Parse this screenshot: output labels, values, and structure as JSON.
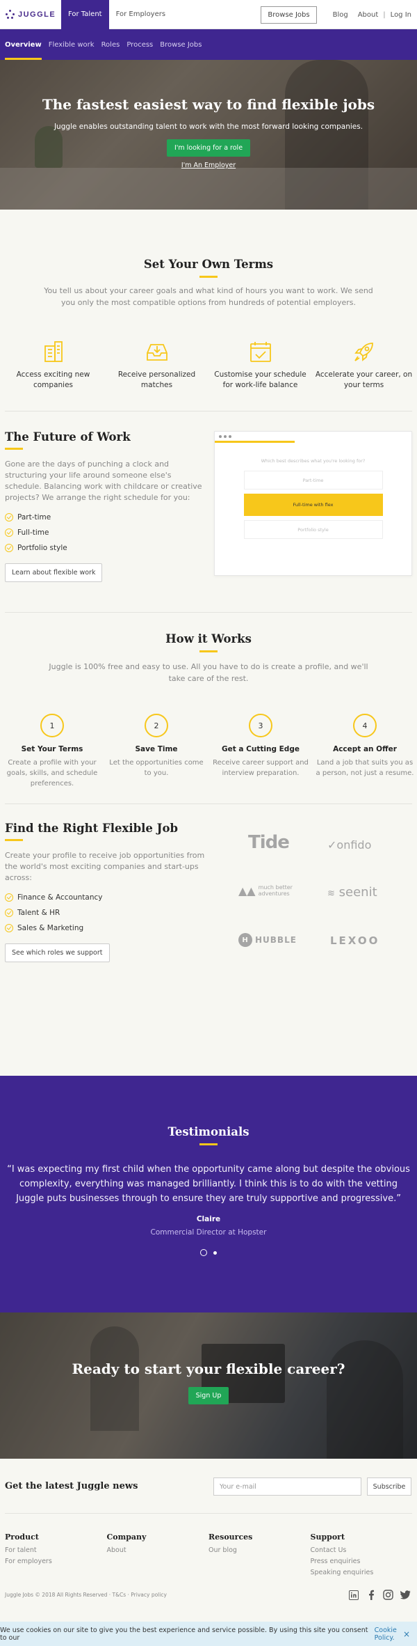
{
  "topnav": {
    "logo": "JUGGLE",
    "tab_talent": "For Talent",
    "tab_employers": "For Employers",
    "browse_jobs": "Browse Jobs",
    "blog": "Blog",
    "about": "About",
    "separator": "|",
    "login": "Log In"
  },
  "subnav": {
    "items": [
      "Overview",
      "Flexible work",
      "Roles",
      "Process",
      "Browse Jobs"
    ],
    "active": "Overview"
  },
  "hero": {
    "title": "The fastest easiest way to find flexible jobs",
    "subtitle": "Juggle enables outstanding talent to work with the most forward looking companies.",
    "cta": "I'm looking for a role",
    "employer_link": "I'm An Employer"
  },
  "terms": {
    "title": "Set Your Own Terms",
    "lead": "You tell us about your career goals and what kind of hours you want to work. We send you only the most compatible options from hundreds of potential employers.",
    "features": [
      {
        "icon": "buildings-icon",
        "label": "Access exciting new companies"
      },
      {
        "icon": "inbox-icon",
        "label": "Receive personalized matches"
      },
      {
        "icon": "calendar-check-icon",
        "label": "Customise your schedule for work-life balance"
      },
      {
        "icon": "rocket-icon",
        "label": "Accelerate your career, on your terms"
      }
    ]
  },
  "future": {
    "title": "The Future of Work",
    "text": "Gone are the days of punching a clock and structuring your life around someone else's schedule. Balancing work with childcare or creative projects? We arrange the right schedule for you:",
    "checks": [
      "Part-time",
      "Full-time",
      "Portfolio style"
    ],
    "button": "Learn about flexible work",
    "mock": {
      "question": "Which best describes what you're looking for?",
      "options": [
        "Part-time",
        "Full-time with flex",
        "Portfolio style"
      ]
    }
  },
  "how": {
    "title": "How it Works",
    "lead": "Juggle is 100% free and easy to use. All you have to do is create a profile, and we'll take care of the rest.",
    "steps": [
      {
        "num": "1",
        "title": "Set Your Terms",
        "desc": "Create a profile with your goals, skills, and schedule preferences."
      },
      {
        "num": "2",
        "title": "Save Time",
        "desc": "Let the opportunities come to you."
      },
      {
        "num": "3",
        "title": "Get a Cutting Edge",
        "desc": "Receive career support and interview preparation."
      },
      {
        "num": "4",
        "title": "Accept an Offer",
        "desc": "Land a job that suits you as a person, not just a resume."
      }
    ]
  },
  "flexjob": {
    "title": "Find the Right Flexible Job",
    "text": "Create your profile to receive job opportunities from the world's most exciting companies and start-ups across:",
    "checks": [
      "Finance & Accountancy",
      "Talent & HR",
      "Sales & Marketing"
    ],
    "button": "See which roles we support",
    "logos": {
      "tide": "Tide",
      "onfido": "onfido",
      "mba": "much better adventures",
      "seenit": "seenit",
      "hubble": "HUBBLE",
      "lexoo": "LEXOO"
    }
  },
  "testimonials": {
    "title": "Testimonials",
    "quote": "“I was expecting my first child when the opportunity came along but despite the obvious complexity, everything was managed brilliantly. I think this is to do with the vetting Juggle puts businesses through to ensure they are truly supportive and progressive.”",
    "name": "Claire",
    "role": "Commercial Director at Hopster"
  },
  "ready": {
    "title": "Ready to start your flexible career?",
    "cta": "Sign Up"
  },
  "news": {
    "title": "Get the latest Juggle news",
    "placeholder": "Your e-mail",
    "button": "Subscribe"
  },
  "footer": {
    "columns": [
      {
        "heading": "Product",
        "links": [
          "For talent",
          "For employers"
        ]
      },
      {
        "heading": "Company",
        "links": [
          "About"
        ]
      },
      {
        "heading": "Resources",
        "links": [
          "Our blog"
        ]
      },
      {
        "heading": "Support",
        "links": [
          "Contact Us",
          "Press enquiries",
          "Speaking enquiries"
        ]
      }
    ],
    "copyright": "Juggle Jobs © 2018 All Rights Reserved  ·  T&Cs  ·  Privacy policy"
  },
  "cookie": {
    "text": "We use cookies on our site to give you the best experience and service possible. By using this site you consent to our",
    "link": "Cookie Policy.",
    "close": "×"
  },
  "colors": {
    "brand_purple": "#3f2690",
    "accent_yellow": "#f7c71b",
    "cta_green": "#21a656"
  }
}
